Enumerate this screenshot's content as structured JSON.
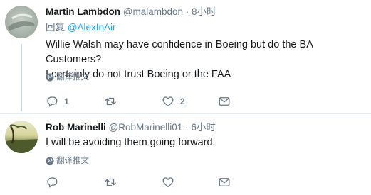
{
  "tweets": [
    {
      "name": "Martin Lambdon",
      "handle": "@malambdon",
      "dot": "·",
      "time": "8小时",
      "reply_prefix": "回复",
      "reply_to": "@AlexInAir",
      "body_line1": "Willie Walsh may have confidence in Boeing but do the BA Customers?",
      "body_line2": "I certainly do not trust Boeing or the FAA",
      "translate_label": "翻译推文",
      "reply_count": "1",
      "retweet_count": "",
      "like_count": "2"
    },
    {
      "name": "Rob Marinelli",
      "handle": "@RobMarinelli01",
      "dot": "·",
      "time": "6小时",
      "body_line1": "I will be avoiding them going forward.",
      "translate_label": "翻译推文",
      "reply_count": "",
      "retweet_count": "",
      "like_count": ""
    }
  ],
  "icons": {
    "reply": "reply-icon",
    "retweet": "retweet-icon",
    "like": "heart-icon",
    "dm": "envelope-icon",
    "translate": "globe-icon"
  },
  "colors": {
    "link": "#1da1f2",
    "secondary_text": "#657786",
    "thread_line": "#ccd6dd"
  }
}
